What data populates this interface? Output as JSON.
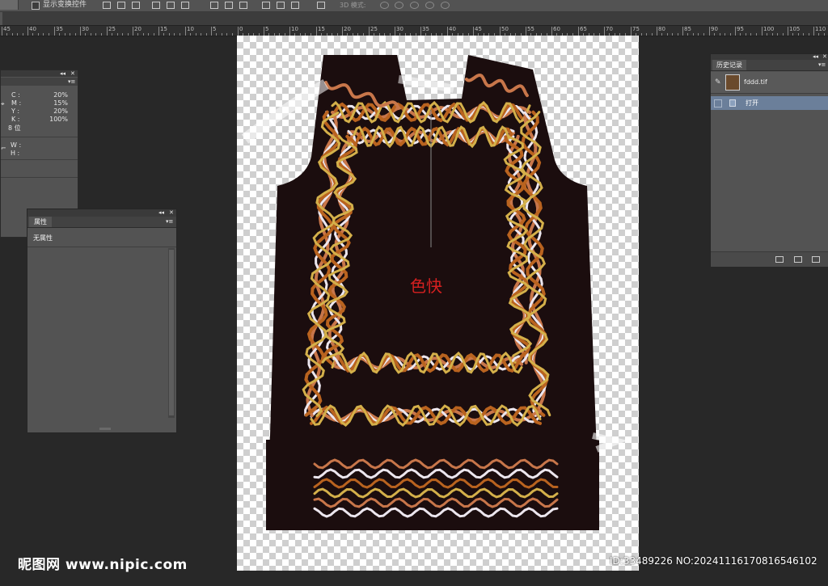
{
  "options_bar": {
    "show_transform_label": "显示变换控件",
    "mode_label": "3D 模式:"
  },
  "ruler": {
    "labels": [
      "45",
      "40",
      "35",
      "30",
      "25",
      "20",
      "15",
      "10",
      "5",
      "0",
      "5",
      "10",
      "15",
      "20",
      "25",
      "30",
      "35",
      "40",
      "45",
      "50",
      "55",
      "60",
      "65",
      "70",
      "75",
      "80",
      "85",
      "90",
      "95",
      "100",
      "105",
      "110"
    ]
  },
  "info_panel": {
    "cmyk": [
      {
        "label": "C :",
        "value": "20%"
      },
      {
        "label": "M :",
        "value": "15%"
      },
      {
        "label": "Y :",
        "value": "20%"
      },
      {
        "label": "K :",
        "value": "100%"
      }
    ],
    "bit_depth": "8 位",
    "w_label": "W :",
    "h_label": "H :"
  },
  "properties_panel": {
    "tab_label": "属性",
    "empty_text": "无属性"
  },
  "canvas": {
    "color_label": "色快",
    "garment_color": "#1b0d0e",
    "chain_colors": [
      "#c8764a",
      "#ece6ee",
      "#b9631f",
      "#d4b04a"
    ]
  },
  "history_panel": {
    "tab_label": "历史记录",
    "snapshot_name": "fddd.tif",
    "items": [
      {
        "label": "打开"
      }
    ]
  },
  "watermark": {
    "brand": "昵图网 www.nipic.com",
    "id_text": "ID:33489226 NO:20241116170816546102"
  }
}
